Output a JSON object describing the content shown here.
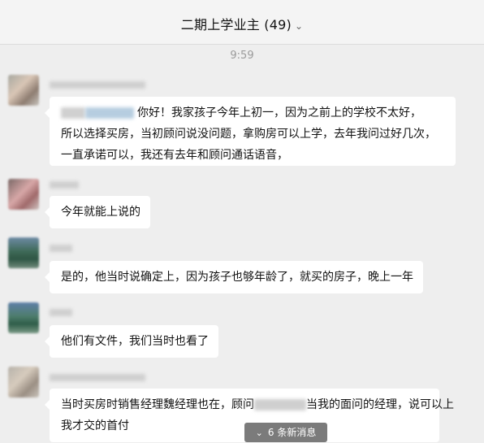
{
  "header": {
    "title": "二期上学业主 (49)",
    "chevron": "chevron-down-icon"
  },
  "timestamp": "9:59",
  "messages": [
    {
      "lines": [
        "你好！我家孩子今年上初一，因为之前上的学校不太好，",
        "所以选择买房，当初顾问说没问题，拿购房可以上学，去年我问过好几次，",
        "一直承诺可以，我还有去年和顾问通话语音，"
      ]
    },
    {
      "lines": [
        "今年就能上说的"
      ]
    },
    {
      "lines": [
        "是的，他当时说确定上，因为孩子也够年龄了，就买的房子，晚上一年"
      ]
    },
    {
      "lines": [
        "他们有文件，我们当时也看了"
      ]
    },
    {
      "lines": [
        "当时买房时销售经理魏经理也在，顾问",
        "当我的面问的经理，说可以上",
        "我才交的首付"
      ]
    }
  ],
  "new_messages": {
    "label": "6 条新消息",
    "icon": "double-chevron-down-icon"
  }
}
